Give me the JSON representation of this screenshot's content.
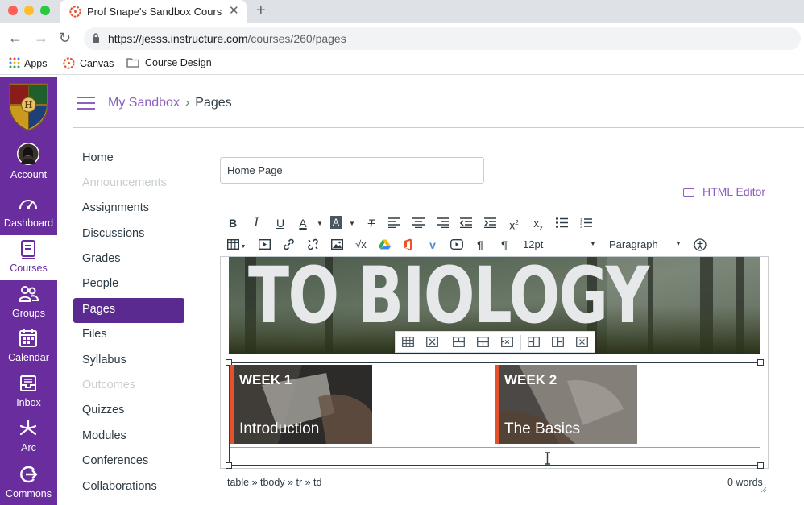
{
  "browser": {
    "tab_title": "Prof Snape's Sandbox Course",
    "new_tab_icon": "plus-icon",
    "url_host": "https://jesss.instructure.com",
    "url_path": "/courses/260/pages",
    "bookmarks": [
      {
        "label": "Apps",
        "icon": "apps-grid-icon"
      },
      {
        "label": "Canvas",
        "icon": "canvas-logo-icon"
      },
      {
        "label": "Course Design",
        "icon": "folder-icon"
      }
    ]
  },
  "global_nav": {
    "items": [
      {
        "label": "Account",
        "icon": "avatar"
      },
      {
        "label": "Dashboard",
        "icon": "dashboard-icon"
      },
      {
        "label": "Courses",
        "icon": "courses-icon",
        "active": true
      },
      {
        "label": "Groups",
        "icon": "groups-icon"
      },
      {
        "label": "Calendar",
        "icon": "calendar-icon"
      },
      {
        "label": "Inbox",
        "icon": "inbox-icon"
      },
      {
        "label": "Arc",
        "icon": "arc-icon"
      },
      {
        "label": "Commons",
        "icon": "commons-icon"
      }
    ],
    "color": "#6a2d9e"
  },
  "header": {
    "breadcrumb_course": "My Sandbox",
    "breadcrumb_separator": "›",
    "breadcrumb_current": "Pages"
  },
  "course_nav": {
    "items": [
      {
        "label": "Home",
        "state": "normal"
      },
      {
        "label": "Announcements",
        "state": "disabled"
      },
      {
        "label": "Assignments",
        "state": "normal"
      },
      {
        "label": "Discussions",
        "state": "normal"
      },
      {
        "label": "Grades",
        "state": "normal"
      },
      {
        "label": "People",
        "state": "normal"
      },
      {
        "label": "Pages",
        "state": "active"
      },
      {
        "label": "Files",
        "state": "normal"
      },
      {
        "label": "Syllabus",
        "state": "normal"
      },
      {
        "label": "Outcomes",
        "state": "disabled"
      },
      {
        "label": "Quizzes",
        "state": "normal"
      },
      {
        "label": "Modules",
        "state": "normal"
      },
      {
        "label": "Conferences",
        "state": "normal"
      },
      {
        "label": "Collaborations",
        "state": "normal"
      }
    ]
  },
  "editor": {
    "page_title_value": "Home Page",
    "html_editor_label": "HTML Editor",
    "font_size": "12pt",
    "block_format": "Paragraph",
    "banner_text": "TO BIOLOGY",
    "weeks": [
      {
        "label": "WEEK 1",
        "title": "Introduction"
      },
      {
        "label": "WEEK 2",
        "title": "The Basics"
      }
    ],
    "status_path": "table » tbody » tr » td",
    "word_count": "0 words"
  },
  "colors": {
    "accent": "#8d5fc0",
    "active_nav": "#5b2a91",
    "week_stripe": "#e4512a"
  }
}
